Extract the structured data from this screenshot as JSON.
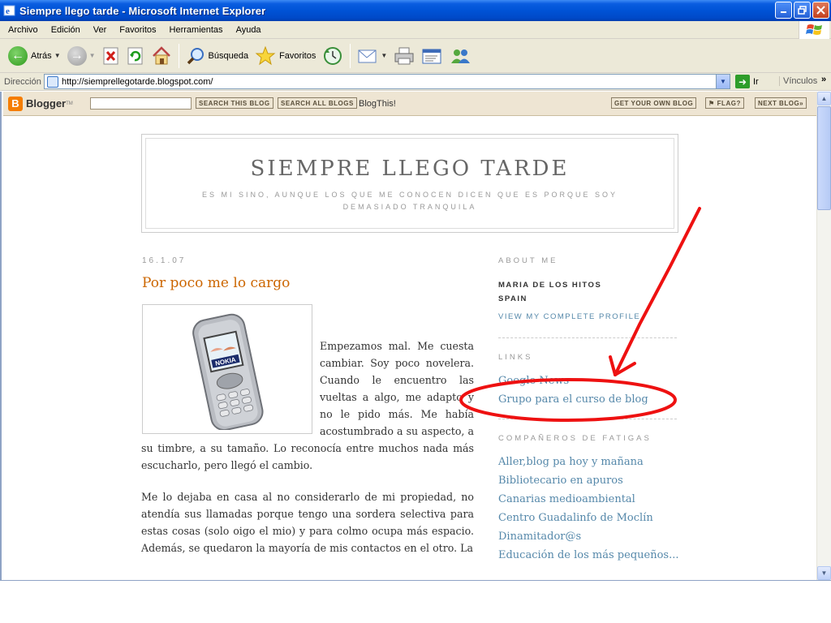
{
  "window": {
    "title": "Siempre llego tarde - Microsoft Internet Explorer"
  },
  "menubar": {
    "items": [
      "Archivo",
      "Edición",
      "Ver",
      "Favoritos",
      "Herramientas",
      "Ayuda"
    ]
  },
  "toolbar": {
    "back_label": "Atrás",
    "search_label": "Búsqueda",
    "favorites_label": "Favoritos"
  },
  "address": {
    "label": "Dirección",
    "url": "http://siemprellegotarde.blogspot.com/",
    "go_label": "Ir",
    "links_label": "Vínculos"
  },
  "blogger_nav": {
    "logo": "Blogger",
    "search_this_blog": "SEARCH THIS BLOG",
    "search_all_blogs": "SEARCH ALL BLOGS",
    "blogthis": "BlogThis!",
    "get_your_own": "GET YOUR OWN BLOG",
    "flag": "FLAG?",
    "next_blog": "NEXT BLOG»"
  },
  "blog": {
    "title": "SIEMPRE LLEGO TARDE",
    "description": "ES MI SINO, AUNQUE LOS QUE ME CONOCEN DICEN QUE ES PORQUE SOY DEMASIADO TRANQUILA"
  },
  "post": {
    "date": "16.1.07",
    "title": "Por poco me lo cargo",
    "image_brand": "NOKIA",
    "paragraph1": "Empezamos mal. Me cuesta cambiar. Soy poco novelera. Cuando le encuentro las vueltas a algo, me adapto y no le pido más. Me había acostumbrado a su aspecto, a su timbre, a su tamaño. Lo reconocía entre muchos nada más escucharlo, pero llegó el cambio.",
    "paragraph2": "Me lo dejaba en casa al no considerarlo de mi propiedad, no atendía sus llamadas porque tengo una sordera selectiva para estas cosas (solo oigo el mio) y para colmo ocupa más espacio. Además, se quedaron la mayoría de mis contactos en el otro. La"
  },
  "sidebar": {
    "about_heading": "ABOUT ME",
    "profile_name": "MARIA DE LOS HITOS",
    "profile_location": "SPAIN",
    "profile_link": "VIEW MY COMPLETE PROFILE",
    "links_heading": "LINKS",
    "links": [
      "Google News",
      "Grupo para el curso de blog"
    ],
    "companions_heading": "COMPAÑEROS DE FATIGAS",
    "companions": [
      "Aller,blog pa hoy y mañana",
      "Bibliotecario en apuros",
      "Canarias medioambiental",
      "Centro Guadalinfo de Moclín",
      "Dinamitador@s",
      "Educación de los más pequeños..."
    ]
  },
  "colors": {
    "annotation": "#ee1111",
    "post_title": "#cc6600",
    "link": "#5588aa"
  }
}
